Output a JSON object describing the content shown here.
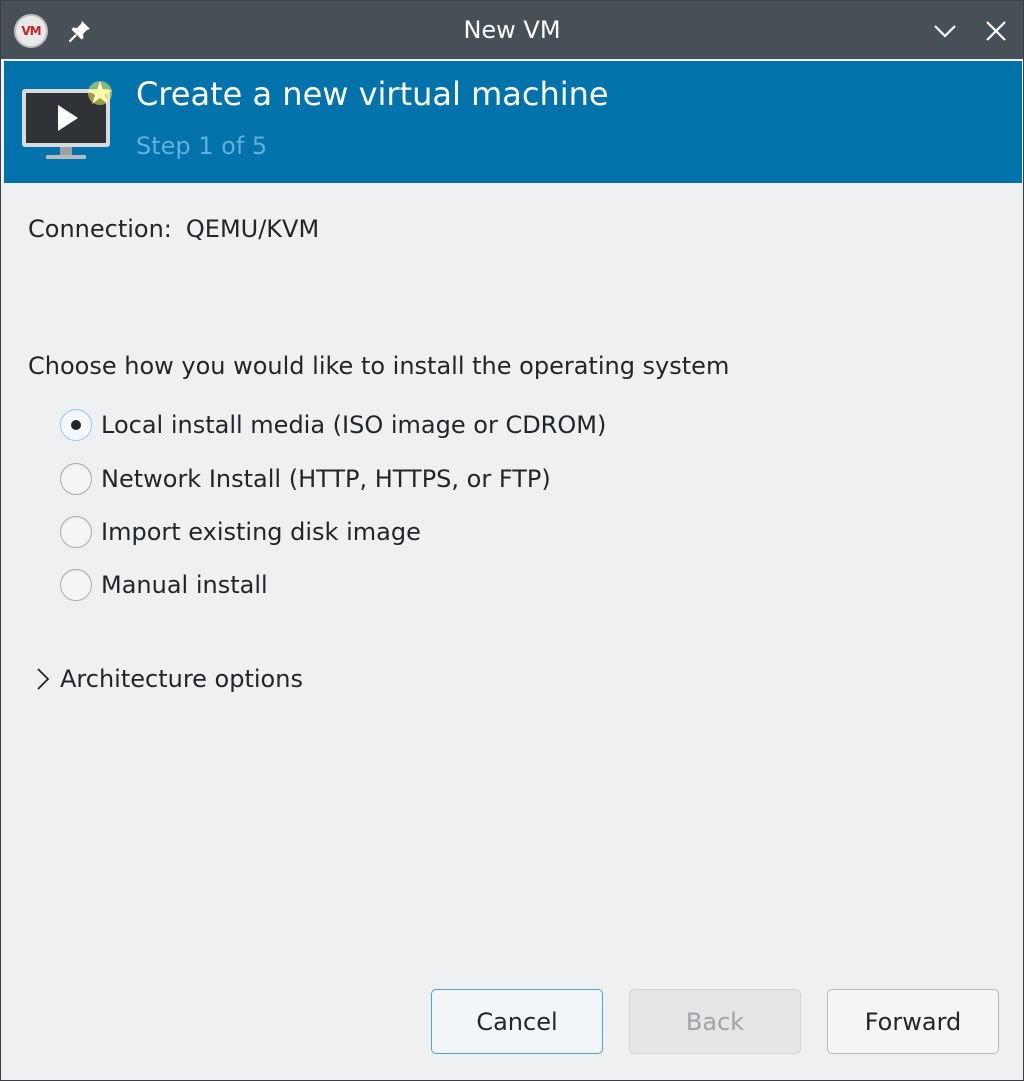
{
  "window": {
    "title": "New VM",
    "app_icon_text": "VM",
    "icons": [
      "vm-app-icon",
      "pin-icon",
      "chevron-down-icon",
      "close-icon"
    ]
  },
  "banner": {
    "title": "Create a new virtual machine",
    "step": "Step 1 of 5",
    "icon": "monitor-play-icon",
    "bg_color": "#0172aa",
    "step_color": "#5fb1dc"
  },
  "connection": {
    "label": "Connection:",
    "value": "QEMU/KVM"
  },
  "install": {
    "prompt": "Choose how you would like to install the operating system",
    "options": [
      {
        "label": "Local install media (ISO image or CDROM)",
        "selected": true
      },
      {
        "label": "Network Install (HTTP, HTTPS, or FTP)",
        "selected": false
      },
      {
        "label": "Import existing disk image",
        "selected": false
      },
      {
        "label": "Manual install",
        "selected": false
      }
    ]
  },
  "architecture": {
    "label": "Architecture options",
    "expanded": false
  },
  "buttons": {
    "cancel": "Cancel",
    "back": "Back",
    "back_enabled": false,
    "forward": "Forward"
  }
}
